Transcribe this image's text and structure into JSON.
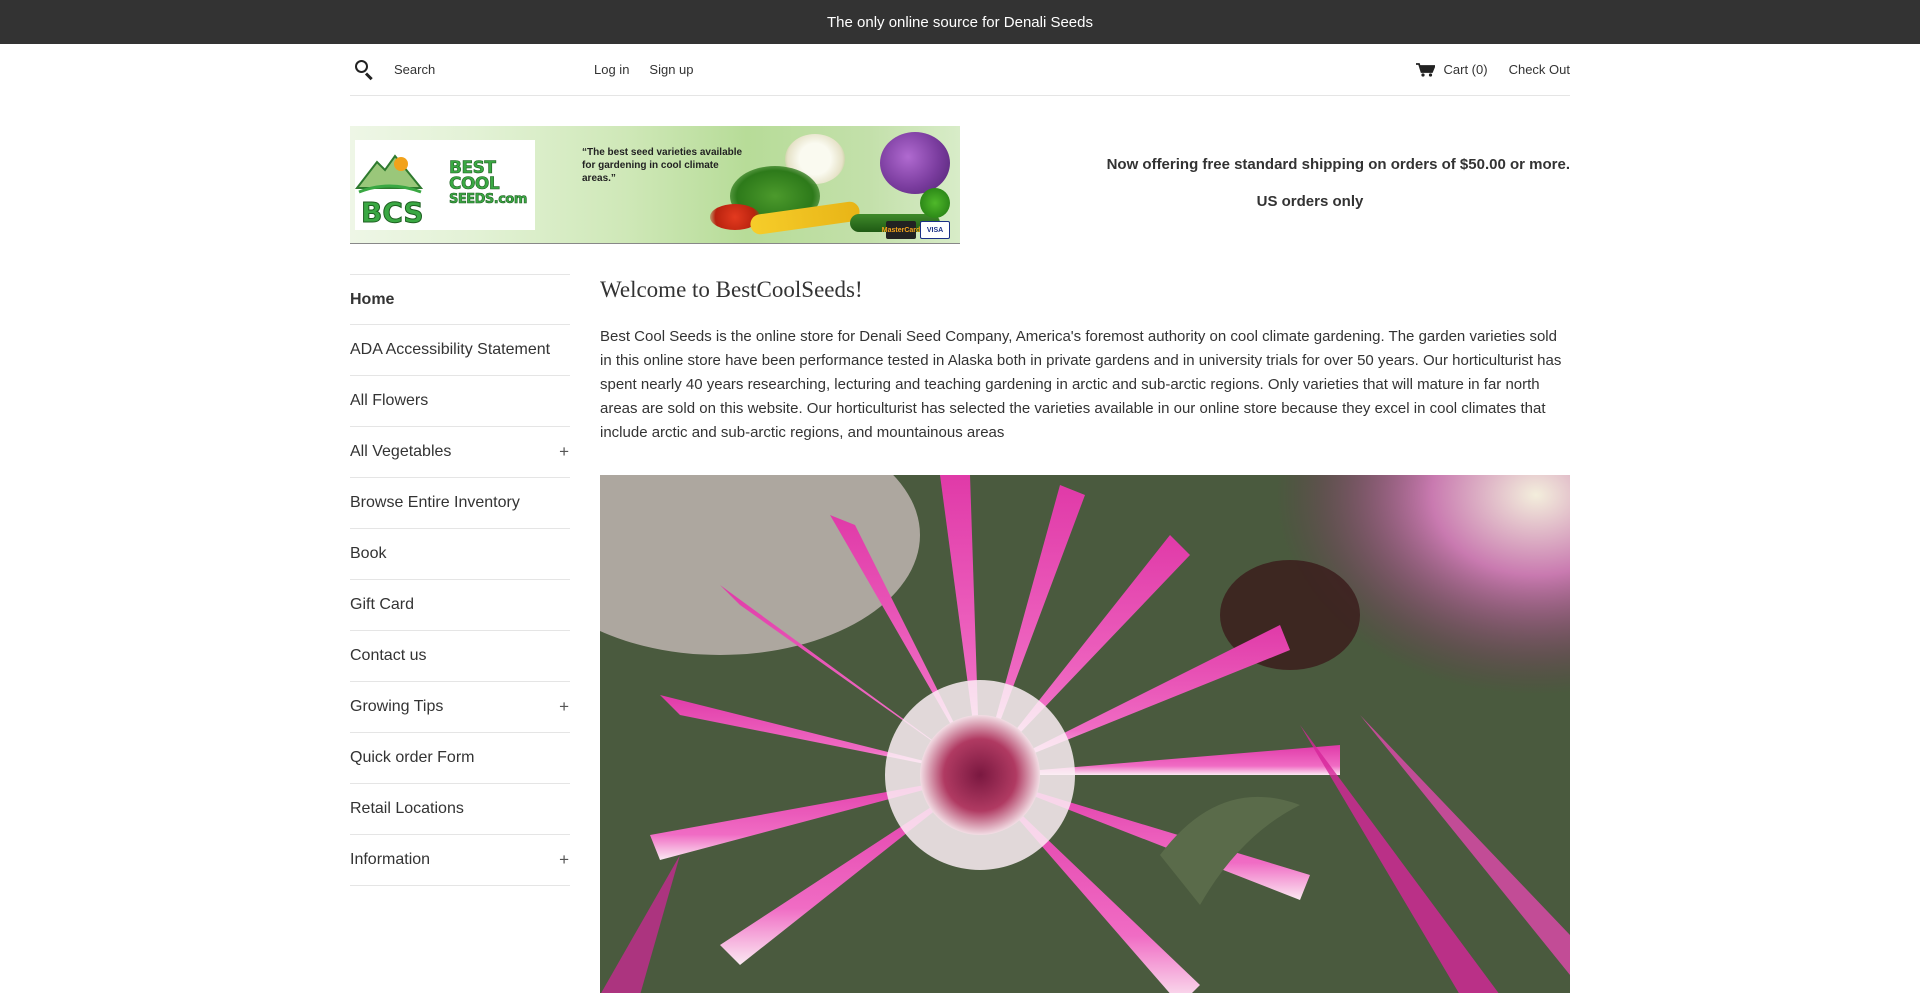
{
  "announcement": {
    "text": "The only online source for Denali Seeds"
  },
  "toolbar": {
    "search_placeholder": "Search",
    "login": "Log in",
    "signup": "Sign up",
    "cart": "Cart (0)",
    "checkout": "Check Out"
  },
  "banner": {
    "logo_text": [
      "BEST",
      "COOL",
      "SEEDS.com"
    ],
    "logo_initials": "BCS",
    "quote": "“The best seed varieties available for gardening in cool climate areas.”",
    "card_mastercard": "MasterCard",
    "card_visa": "VISA"
  },
  "shipping": {
    "line1": "Now offering free standard shipping on orders of $50.00 or more.",
    "line2": "US orders only"
  },
  "sidebar": {
    "items": [
      {
        "label": "Home",
        "expandable": false,
        "active": true
      },
      {
        "label": "ADA Accessibility Statement",
        "expandable": false
      },
      {
        "label": "All Flowers",
        "expandable": false
      },
      {
        "label": "All Vegetables",
        "expandable": true
      },
      {
        "label": "Browse Entire Inventory",
        "expandable": false
      },
      {
        "label": "Book",
        "expandable": false
      },
      {
        "label": "Gift Card",
        "expandable": false
      },
      {
        "label": "Contact us",
        "expandable": false
      },
      {
        "label": "Growing Tips",
        "expandable": true
      },
      {
        "label": "Quick order Form",
        "expandable": false
      },
      {
        "label": "Retail Locations",
        "expandable": false
      },
      {
        "label": "Information",
        "expandable": true
      }
    ],
    "expand_symbol": "+"
  },
  "main": {
    "title": "Welcome to BestCoolSeeds!",
    "intro": "Best Cool Seeds is the online store for Denali Seed Company, America's foremost authority on cool climate gardening. The garden varieties sold in this online store have been performance tested in Alaska both in private gardens and in university trials for over 50 years. Our horticulturist has spent nearly 40 years researching, lecturing and teaching gardening in arctic and sub-arctic regions. Only varieties that will mature in far north areas are sold on this website. Our horticulturist has selected the varieties available in our online store because they excel in cool climates that include arctic and sub-arctic regions, and mountainous areas"
  },
  "colors": {
    "announcement_bg": "#333333",
    "text": "#333333",
    "border": "#e5e5e5",
    "flower_magenta": "#d6269a"
  }
}
